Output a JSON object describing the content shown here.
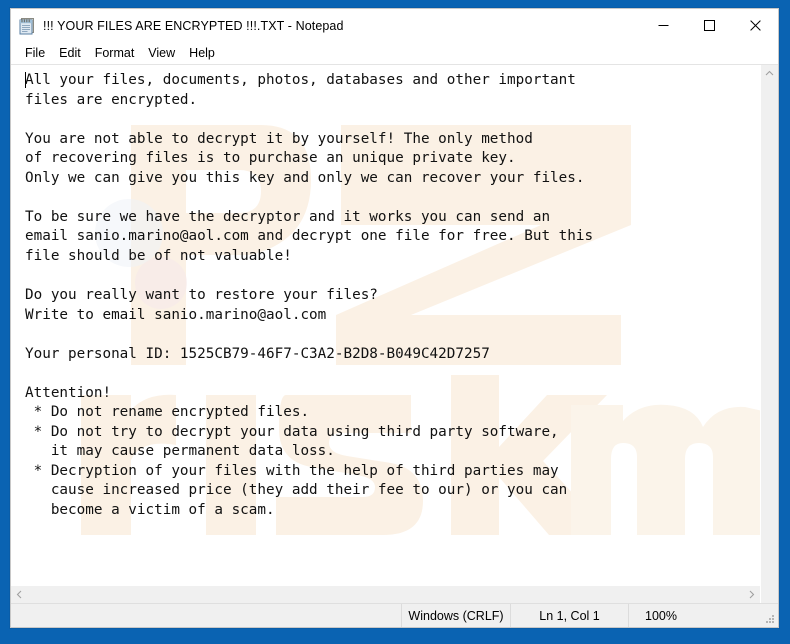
{
  "window": {
    "title": "!!! YOUR FILES ARE ENCRYPTED !!!.TXT - Notepad",
    "icon": "notepad-icon",
    "controls": {
      "minimize": "minimize-icon",
      "maximize": "maximize-icon",
      "close": "close-icon"
    }
  },
  "menubar": {
    "items": [
      {
        "label": "File"
      },
      {
        "label": "Edit"
      },
      {
        "label": "Format"
      },
      {
        "label": "View"
      },
      {
        "label": "Help"
      }
    ]
  },
  "document": {
    "filename": "!!! YOUR FILES ARE ENCRYPTED !!!.TXT",
    "body": "All your files, documents, photos, databases and other important\nfiles are encrypted.\n\nYou are not able to decrypt it by yourself! The only method\nof recovering files is to purchase an unique private key.\nOnly we can give you this key and only we can recover your files.\n\nTo be sure we have the decryptor and it works you can send an\nemail sanio.marino@aol.com and decrypt one file for free. But this\nfile should be of not valuable!\n\nDo you really want to restore your files?\nWrite to email sanio.marino@aol.com\n\nYour personal ID: 1525CB79-46F7-C3A2-B2D8-B049C42D7257\n\nAttention!\n * Do not rename encrypted files.\n * Do not try to decrypt your data using third party software,\n   it may cause permanent data loss.\n * Decryption of your files with the help of third parties may\n   cause increased price (they add their fee to our) or you can\n   become a victim of a scam.",
    "contact_email": "sanio.marino@aol.com",
    "personal_id": "1525CB79-46F7-C3A2-B2D8-B049C42D7257"
  },
  "scrollbars": {
    "vertical_up": "chevron-up-icon",
    "vertical_down": "chevron-down-icon",
    "horizontal_left": "chevron-left-icon",
    "horizontal_right": "chevron-right-icon"
  },
  "statusbar": {
    "line_ending": "Windows (CRLF)",
    "cursor": "Ln 1, Col 1",
    "zoom": "100%"
  },
  "watermark": {
    "text": "pcrisk.com"
  },
  "colors": {
    "desktop_blue": "#0a63b2",
    "window_bg": "#ffffff",
    "chrome_gray": "#f0f0f0",
    "text": "#111111",
    "watermark": "#faf0e6"
  }
}
